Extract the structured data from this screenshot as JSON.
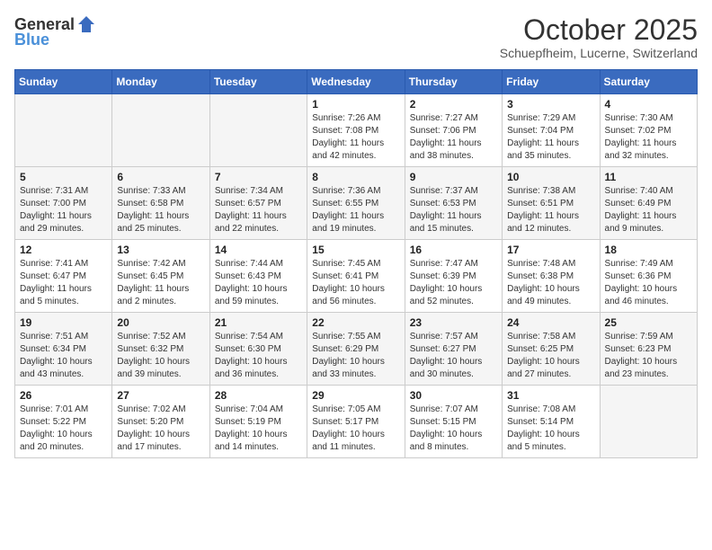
{
  "header": {
    "logo_general": "General",
    "logo_blue": "Blue",
    "month": "October 2025",
    "location": "Schuepfheim, Lucerne, Switzerland"
  },
  "weekdays": [
    "Sunday",
    "Monday",
    "Tuesday",
    "Wednesday",
    "Thursday",
    "Friday",
    "Saturday"
  ],
  "weeks": [
    [
      null,
      null,
      null,
      {
        "day": 1,
        "sunrise": "7:26 AM",
        "sunset": "7:08 PM",
        "daylight": "11 hours and 42 minutes."
      },
      {
        "day": 2,
        "sunrise": "7:27 AM",
        "sunset": "7:06 PM",
        "daylight": "11 hours and 38 minutes."
      },
      {
        "day": 3,
        "sunrise": "7:29 AM",
        "sunset": "7:04 PM",
        "daylight": "11 hours and 35 minutes."
      },
      {
        "day": 4,
        "sunrise": "7:30 AM",
        "sunset": "7:02 PM",
        "daylight": "11 hours and 32 minutes."
      }
    ],
    [
      {
        "day": 5,
        "sunrise": "7:31 AM",
        "sunset": "7:00 PM",
        "daylight": "11 hours and 29 minutes."
      },
      {
        "day": 6,
        "sunrise": "7:33 AM",
        "sunset": "6:58 PM",
        "daylight": "11 hours and 25 minutes."
      },
      {
        "day": 7,
        "sunrise": "7:34 AM",
        "sunset": "6:57 PM",
        "daylight": "11 hours and 22 minutes."
      },
      {
        "day": 8,
        "sunrise": "7:36 AM",
        "sunset": "6:55 PM",
        "daylight": "11 hours and 19 minutes."
      },
      {
        "day": 9,
        "sunrise": "7:37 AM",
        "sunset": "6:53 PM",
        "daylight": "11 hours and 15 minutes."
      },
      {
        "day": 10,
        "sunrise": "7:38 AM",
        "sunset": "6:51 PM",
        "daylight": "11 hours and 12 minutes."
      },
      {
        "day": 11,
        "sunrise": "7:40 AM",
        "sunset": "6:49 PM",
        "daylight": "11 hours and 9 minutes."
      }
    ],
    [
      {
        "day": 12,
        "sunrise": "7:41 AM",
        "sunset": "6:47 PM",
        "daylight": "11 hours and 5 minutes."
      },
      {
        "day": 13,
        "sunrise": "7:42 AM",
        "sunset": "6:45 PM",
        "daylight": "11 hours and 2 minutes."
      },
      {
        "day": 14,
        "sunrise": "7:44 AM",
        "sunset": "6:43 PM",
        "daylight": "10 hours and 59 minutes."
      },
      {
        "day": 15,
        "sunrise": "7:45 AM",
        "sunset": "6:41 PM",
        "daylight": "10 hours and 56 minutes."
      },
      {
        "day": 16,
        "sunrise": "7:47 AM",
        "sunset": "6:39 PM",
        "daylight": "10 hours and 52 minutes."
      },
      {
        "day": 17,
        "sunrise": "7:48 AM",
        "sunset": "6:38 PM",
        "daylight": "10 hours and 49 minutes."
      },
      {
        "day": 18,
        "sunrise": "7:49 AM",
        "sunset": "6:36 PM",
        "daylight": "10 hours and 46 minutes."
      }
    ],
    [
      {
        "day": 19,
        "sunrise": "7:51 AM",
        "sunset": "6:34 PM",
        "daylight": "10 hours and 43 minutes."
      },
      {
        "day": 20,
        "sunrise": "7:52 AM",
        "sunset": "6:32 PM",
        "daylight": "10 hours and 39 minutes."
      },
      {
        "day": 21,
        "sunrise": "7:54 AM",
        "sunset": "6:30 PM",
        "daylight": "10 hours and 36 minutes."
      },
      {
        "day": 22,
        "sunrise": "7:55 AM",
        "sunset": "6:29 PM",
        "daylight": "10 hours and 33 minutes."
      },
      {
        "day": 23,
        "sunrise": "7:57 AM",
        "sunset": "6:27 PM",
        "daylight": "10 hours and 30 minutes."
      },
      {
        "day": 24,
        "sunrise": "7:58 AM",
        "sunset": "6:25 PM",
        "daylight": "10 hours and 27 minutes."
      },
      {
        "day": 25,
        "sunrise": "7:59 AM",
        "sunset": "6:23 PM",
        "daylight": "10 hours and 23 minutes."
      }
    ],
    [
      {
        "day": 26,
        "sunrise": "7:01 AM",
        "sunset": "5:22 PM",
        "daylight": "10 hours and 20 minutes."
      },
      {
        "day": 27,
        "sunrise": "7:02 AM",
        "sunset": "5:20 PM",
        "daylight": "10 hours and 17 minutes."
      },
      {
        "day": 28,
        "sunrise": "7:04 AM",
        "sunset": "5:19 PM",
        "daylight": "10 hours and 14 minutes."
      },
      {
        "day": 29,
        "sunrise": "7:05 AM",
        "sunset": "5:17 PM",
        "daylight": "10 hours and 11 minutes."
      },
      {
        "day": 30,
        "sunrise": "7:07 AM",
        "sunset": "5:15 PM",
        "daylight": "10 hours and 8 minutes."
      },
      {
        "day": 31,
        "sunrise": "7:08 AM",
        "sunset": "5:14 PM",
        "daylight": "10 hours and 5 minutes."
      },
      null
    ]
  ],
  "labels": {
    "sunrise": "Sunrise:",
    "sunset": "Sunset:",
    "daylight": "Daylight:"
  }
}
